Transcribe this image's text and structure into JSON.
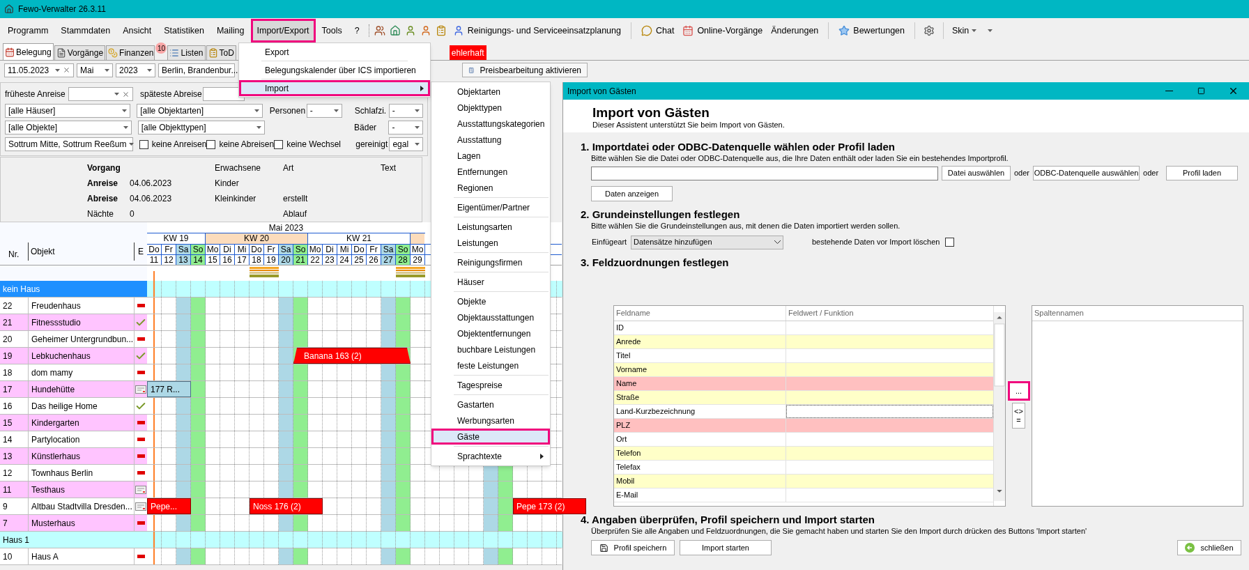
{
  "window": {
    "title": "Fewo-Verwalter 26.3.11"
  },
  "menu_bar": {
    "menus": [
      {
        "label": "Programm",
        "open": false,
        "highlighted": false
      },
      {
        "label": "Stammdaten",
        "open": false,
        "highlighted": false
      },
      {
        "label": "Ansicht",
        "open": false,
        "highlighted": false
      },
      {
        "label": "Statistiken",
        "open": false,
        "highlighted": false
      },
      {
        "label": "Mailing",
        "open": false,
        "highlighted": false
      },
      {
        "label": "Import/Export",
        "open": true,
        "highlighted": true
      },
      {
        "label": "Tools",
        "open": false,
        "highlighted": false
      },
      {
        "label": "?",
        "open": false,
        "highlighted": false
      }
    ],
    "tools": [
      {
        "label": "Reinigungs- und Serviceeinsatzplanung"
      },
      {
        "label": "Chat"
      },
      {
        "label": "Online-Vorgänge"
      },
      {
        "label": "Änderungen"
      },
      {
        "label": "Bewertungen"
      }
    ],
    "skin": "Skin"
  },
  "tabs": [
    {
      "label": "Belegung",
      "selected": true
    },
    {
      "label": "Vorgänge",
      "selected": false
    },
    {
      "label": "Finanzen",
      "selected": false,
      "badge": "10"
    },
    {
      "label": "Listen",
      "selected": false
    },
    {
      "label": "ToD",
      "selected": false
    }
  ],
  "warning_tab": "ehlerhaft",
  "filter_bar": {
    "date": "11.05.2023",
    "month": "Mai",
    "year": "2023",
    "region": "Berlin, Brandenbur...",
    "price_button": "Preisbearbeitung aktivieren"
  },
  "filters": {
    "earliest_arrival": "früheste Anreise",
    "latest_departure": "späteste Abreise",
    "houses": "[alle Häuser]",
    "object_kinds": "[alle Objektarten]",
    "objects": "[alle Objekte]",
    "object_types": "[alle Objekttypen]",
    "location": "Sottrum Mitte, Sottrum Reeßum",
    "persons_label": "Personen",
    "persons": "-",
    "bedrooms_label": "Schlafzi.",
    "bedrooms": "-",
    "baths_label": "Bäder",
    "baths": "-",
    "checkboxes": [
      {
        "label": "keine Anreisen",
        "checked": false
      },
      {
        "label": "keine Abreisen",
        "checked": false
      },
      {
        "label": "keine Wechsel",
        "checked": false
      }
    ],
    "cleaned_label": "gereinigt",
    "cleaned": "egal"
  },
  "booking_info": {
    "col1": [
      {
        "label": "Vorgang",
        "bold": true
      },
      {
        "label": "Anreise",
        "value": "04.06.2023",
        "bold": true
      },
      {
        "label": "Abreise",
        "value": "04.06.2023",
        "bold": true
      },
      {
        "label": "Nächte",
        "value": "0",
        "bold": false
      }
    ],
    "col2": [
      "Erwachsene",
      "Kinder",
      "Kleinkinder"
    ],
    "col3": [
      "Art",
      "erstellt",
      "Ablauf"
    ],
    "col4": [
      "Text"
    ]
  },
  "calendar": {
    "month": "Mai 2023",
    "headers": {
      "nr": "Nr.",
      "object": "Objekt",
      "e": "E"
    },
    "weeks": [
      "KW 19",
      "KW 20",
      "KW 21"
    ],
    "days": [
      {
        "weekday": "Do",
        "day": "11",
        "kind": "weekday"
      },
      {
        "weekday": "Fr",
        "day": "12",
        "kind": "weekday"
      },
      {
        "weekday": "Sa",
        "day": "13",
        "kind": "saturday"
      },
      {
        "weekday": "So",
        "day": "14",
        "kind": "sunday"
      },
      {
        "weekday": "Mo",
        "day": "15",
        "kind": "weekday"
      },
      {
        "weekday": "Di",
        "day": "16",
        "kind": "weekday"
      },
      {
        "weekday": "Mi",
        "day": "17",
        "kind": "weekday"
      },
      {
        "weekday": "Do",
        "day": "18",
        "kind": "weekday"
      },
      {
        "weekday": "Fr",
        "day": "19",
        "kind": "weekday"
      },
      {
        "weekday": "Sa",
        "day": "20",
        "kind": "saturday"
      },
      {
        "weekday": "So",
        "day": "21",
        "kind": "sunday"
      },
      {
        "weekday": "Mo",
        "day": "22",
        "kind": "weekday"
      },
      {
        "weekday": "Di",
        "day": "23",
        "kind": "weekday"
      },
      {
        "weekday": "Mi",
        "day": "24",
        "kind": "weekday"
      },
      {
        "weekday": "Do",
        "day": "25",
        "kind": "weekday"
      },
      {
        "weekday": "Fr",
        "day": "26",
        "kind": "weekday"
      },
      {
        "weekday": "Sa",
        "day": "27",
        "kind": "saturday"
      },
      {
        "weekday": "So",
        "day": "28",
        "kind": "sunday"
      },
      {
        "weekday": "Mo",
        "day": "29",
        "kind": "weekday"
      }
    ],
    "rows": [
      {
        "kind": "group",
        "label": "kein Haus",
        "selected": true
      },
      {
        "kind": "object",
        "nr": "22",
        "name": "Freudenhaus",
        "e": {
          "kind": "dash"
        },
        "color": "#ffffff"
      },
      {
        "kind": "object",
        "nr": "21",
        "name": "Fitnessstudio",
        "e": {
          "kind": "check"
        },
        "color": "#ffc4ff"
      },
      {
        "kind": "object",
        "nr": "20",
        "name": "Geheimer Untergrundbun...",
        "e": {
          "kind": "dash"
        },
        "color": "#ffffff"
      },
      {
        "kind": "object",
        "nr": "19",
        "name": "Lebkuchenhaus",
        "e": {
          "kind": "check"
        },
        "color": "#ffc4ff",
        "bookings": [
          {
            "label": "Banana 163 (2)",
            "kind": "option"
          }
        ]
      },
      {
        "kind": "object",
        "nr": "18",
        "name": "dom mamy",
        "e": {
          "kind": "dash"
        },
        "color": "#ffffff"
      },
      {
        "kind": "object",
        "nr": "17",
        "name": "Hundehütte",
        "e": {
          "kind": "card"
        },
        "color": "#ffc4ff",
        "bookings": [
          {
            "label": "177 R...",
            "kind": "request"
          }
        ]
      },
      {
        "kind": "object",
        "nr": "16",
        "name": "Das heilige Home",
        "e": {
          "kind": "check"
        },
        "color": "#ffffff"
      },
      {
        "kind": "object",
        "nr": "15",
        "name": "Kindergarten",
        "e": {
          "kind": "dash"
        },
        "color": "#ffc4ff"
      },
      {
        "kind": "object",
        "nr": "14",
        "name": "Partylocation",
        "e": {
          "kind": "dash"
        },
        "color": "#ffffff"
      },
      {
        "kind": "object",
        "nr": "13",
        "name": "Künstlerhaus",
        "e": {
          "kind": "dash"
        },
        "color": "#ffc4ff"
      },
      {
        "kind": "object",
        "nr": "12",
        "name": "Townhaus Berlin",
        "e": {
          "kind": "dash"
        },
        "color": "#ffffff"
      },
      {
        "kind": "object",
        "nr": "11",
        "name": "Testhaus",
        "e": {
          "kind": "card"
        },
        "color": "#ffc4ff"
      },
      {
        "kind": "object",
        "nr": "9",
        "name": "Altbau Stadtvilla Dresden...",
        "e": {
          "kind": "card"
        },
        "color": "#ffffff",
        "bookings": [
          {
            "label": "Pepe...",
            "kind": "booked"
          },
          {
            "label": "Noss 176 (2)",
            "kind": "booked"
          },
          {
            "label": "Pepe 173 (2)",
            "kind": "booked"
          }
        ]
      },
      {
        "kind": "object",
        "nr": "7",
        "name": "Musterhaus",
        "e": {
          "kind": "dash"
        },
        "color": "#ffc4ff"
      },
      {
        "kind": "group",
        "label": "Haus 1",
        "selected": false
      },
      {
        "kind": "object",
        "nr": "10",
        "name": "Haus A",
        "e": {
          "kind": "dash"
        },
        "color": "#ffffff"
      }
    ]
  },
  "import_menu": {
    "items": [
      {
        "label": "Export",
        "selected": false,
        "highlighted": false,
        "has_submenu": false
      },
      {
        "label": "Belegungskalender über ICS importieren",
        "selected": false,
        "highlighted": false,
        "has_submenu": false
      },
      {
        "label": "Import",
        "selected": true,
        "highlighted": true,
        "has_submenu": true
      }
    ]
  },
  "import_submenu": {
    "groups": [
      {
        "items": [
          {
            "label": "Objektarten",
            "selected": false,
            "highlighted": false,
            "has_submenu": false
          },
          {
            "label": "Objekttypen",
            "selected": false,
            "highlighted": false,
            "has_submenu": false
          },
          {
            "label": "Ausstattungskategorien",
            "selected": false,
            "highlighted": false,
            "has_submenu": false
          },
          {
            "label": "Ausstattung",
            "selected": false,
            "highlighted": false,
            "has_submenu": false
          },
          {
            "label": "Lagen",
            "selected": false,
            "highlighted": false,
            "has_submenu": false
          },
          {
            "label": "Entfernungen",
            "selected": false,
            "highlighted": false,
            "has_submenu": false
          },
          {
            "label": "Regionen",
            "selected": false,
            "highlighted": false,
            "has_submenu": false
          }
        ]
      },
      {
        "items": [
          {
            "label": "Eigentümer/Partner",
            "selected": false,
            "highlighted": false,
            "has_submenu": false
          }
        ]
      },
      {
        "items": [
          {
            "label": "Leistungsarten",
            "selected": false,
            "highlighted": false,
            "has_submenu": false
          },
          {
            "label": "Leistungen",
            "selected": false,
            "highlighted": false,
            "has_submenu": false
          }
        ]
      },
      {
        "items": [
          {
            "label": "Reinigungsfirmen",
            "selected": false,
            "highlighted": false,
            "has_submenu": false
          }
        ]
      },
      {
        "items": [
          {
            "label": "Häuser",
            "selected": false,
            "highlighted": false,
            "has_submenu": false
          }
        ]
      },
      {
        "items": [
          {
            "label": "Objekte",
            "selected": false,
            "highlighted": false,
            "has_submenu": false
          },
          {
            "label": "Objektausstattungen",
            "selected": false,
            "highlighted": false,
            "has_submenu": false
          },
          {
            "label": "Objektentfernungen",
            "selected": false,
            "highlighted": false,
            "has_submenu": false
          },
          {
            "label": "buchbare Leistungen",
            "selected": false,
            "highlighted": false,
            "has_submenu": false
          },
          {
            "label": "feste Leistungen",
            "selected": false,
            "highlighted": false,
            "has_submenu": false
          }
        ]
      },
      {
        "items": [
          {
            "label": "Tagespreise",
            "selected": false,
            "highlighted": false,
            "has_submenu": false
          }
        ]
      },
      {
        "items": [
          {
            "label": "Gastarten",
            "selected": false,
            "highlighted": false,
            "has_submenu": false
          },
          {
            "label": "Werbungsarten",
            "selected": false,
            "highlighted": false,
            "has_submenu": false
          },
          {
            "label": "Gäste",
            "selected": true,
            "highlighted": true,
            "has_submenu": false
          }
        ]
      },
      {
        "items": [
          {
            "label": "Sprachtexte",
            "selected": false,
            "highlighted": false,
            "has_submenu": true
          }
        ]
      }
    ]
  },
  "import_dialog": {
    "title": "Import von Gästen",
    "heading": "Import von Gästen",
    "subtitle": "Dieser Assistent unterstützt Sie beim Import von Gästen.",
    "step1": {
      "heading": "1. Importdatei oder ODBC-Datenquelle wählen oder Profil laden",
      "description": "Bitte wählen Sie die Datei oder ODBC-Datenquelle aus, die Ihre Daten enthält oder laden Sie ein bestehendes Importprofil.",
      "file_button": "Datei auswählen",
      "or_1": "oder",
      "odbc_button": "ODBC-Datenquelle auswählen",
      "or_2": "oder",
      "profile_button": "Profil laden",
      "show_button": "Daten anzeigen"
    },
    "step2": {
      "heading": "2. Grundeinstellungen festlegen",
      "description": "Bitte wählen Sie die Grundeinstellungen aus, mit denen die Daten importiert werden sollen.",
      "insert_label": "Einfügeart",
      "insert_value": "Datensätze hinzufügen",
      "delete_label": "bestehende Daten vor Import löschen",
      "delete_checked": false
    },
    "step3": {
      "heading": "3. Feldzuordnungen festlegen",
      "columns": [
        "Feldname",
        "Feldwert / Funktion"
      ],
      "rows": [
        {
          "field": "ID",
          "color": "#ffffff",
          "focused": false
        },
        {
          "field": "Anrede",
          "color": "#ffffc8",
          "focused": false
        },
        {
          "field": "Titel",
          "color": "#ffffff",
          "focused": false
        },
        {
          "field": "Vorname",
          "color": "#ffffc8",
          "focused": false
        },
        {
          "field": "Name",
          "color": "#ffc0c0",
          "focused": false
        },
        {
          "field": "Straße",
          "color": "#ffffc8",
          "focused": false
        },
        {
          "field": "Land-Kurzbezeichnung",
          "color": "#ffffff",
          "focused": true
        },
        {
          "field": "PLZ",
          "color": "#ffc0c0",
          "focused": false
        },
        {
          "field": "Ort",
          "color": "#ffffff",
          "focused": false
        },
        {
          "field": "Telefon",
          "color": "#ffffc8",
          "focused": false
        },
        {
          "field": "Telefax",
          "color": "#ffffff",
          "focused": false
        },
        {
          "field": "Mobil",
          "color": "#ffffc8",
          "focused": false
        },
        {
          "field": "E-Mail",
          "color": "#ffffff",
          "focused": false
        }
      ],
      "assign_button": {
        "label": "...",
        "highlighted": true
      },
      "compare_button": [
        "<>",
        "="
      ],
      "source_header": "Spaltennamen"
    },
    "step4": {
      "heading": "4. Angaben überprüfen, Profil speichern und Import starten",
      "description": "Überprüfen Sie alle Angaben und Feldzuordnungen, die Sie gemacht haben und starten Sie den Import durch drücken des Buttons 'Import starten'",
      "save_button": "Profil speichern",
      "start_button": "Import starten",
      "close_button": "schließen"
    }
  }
}
